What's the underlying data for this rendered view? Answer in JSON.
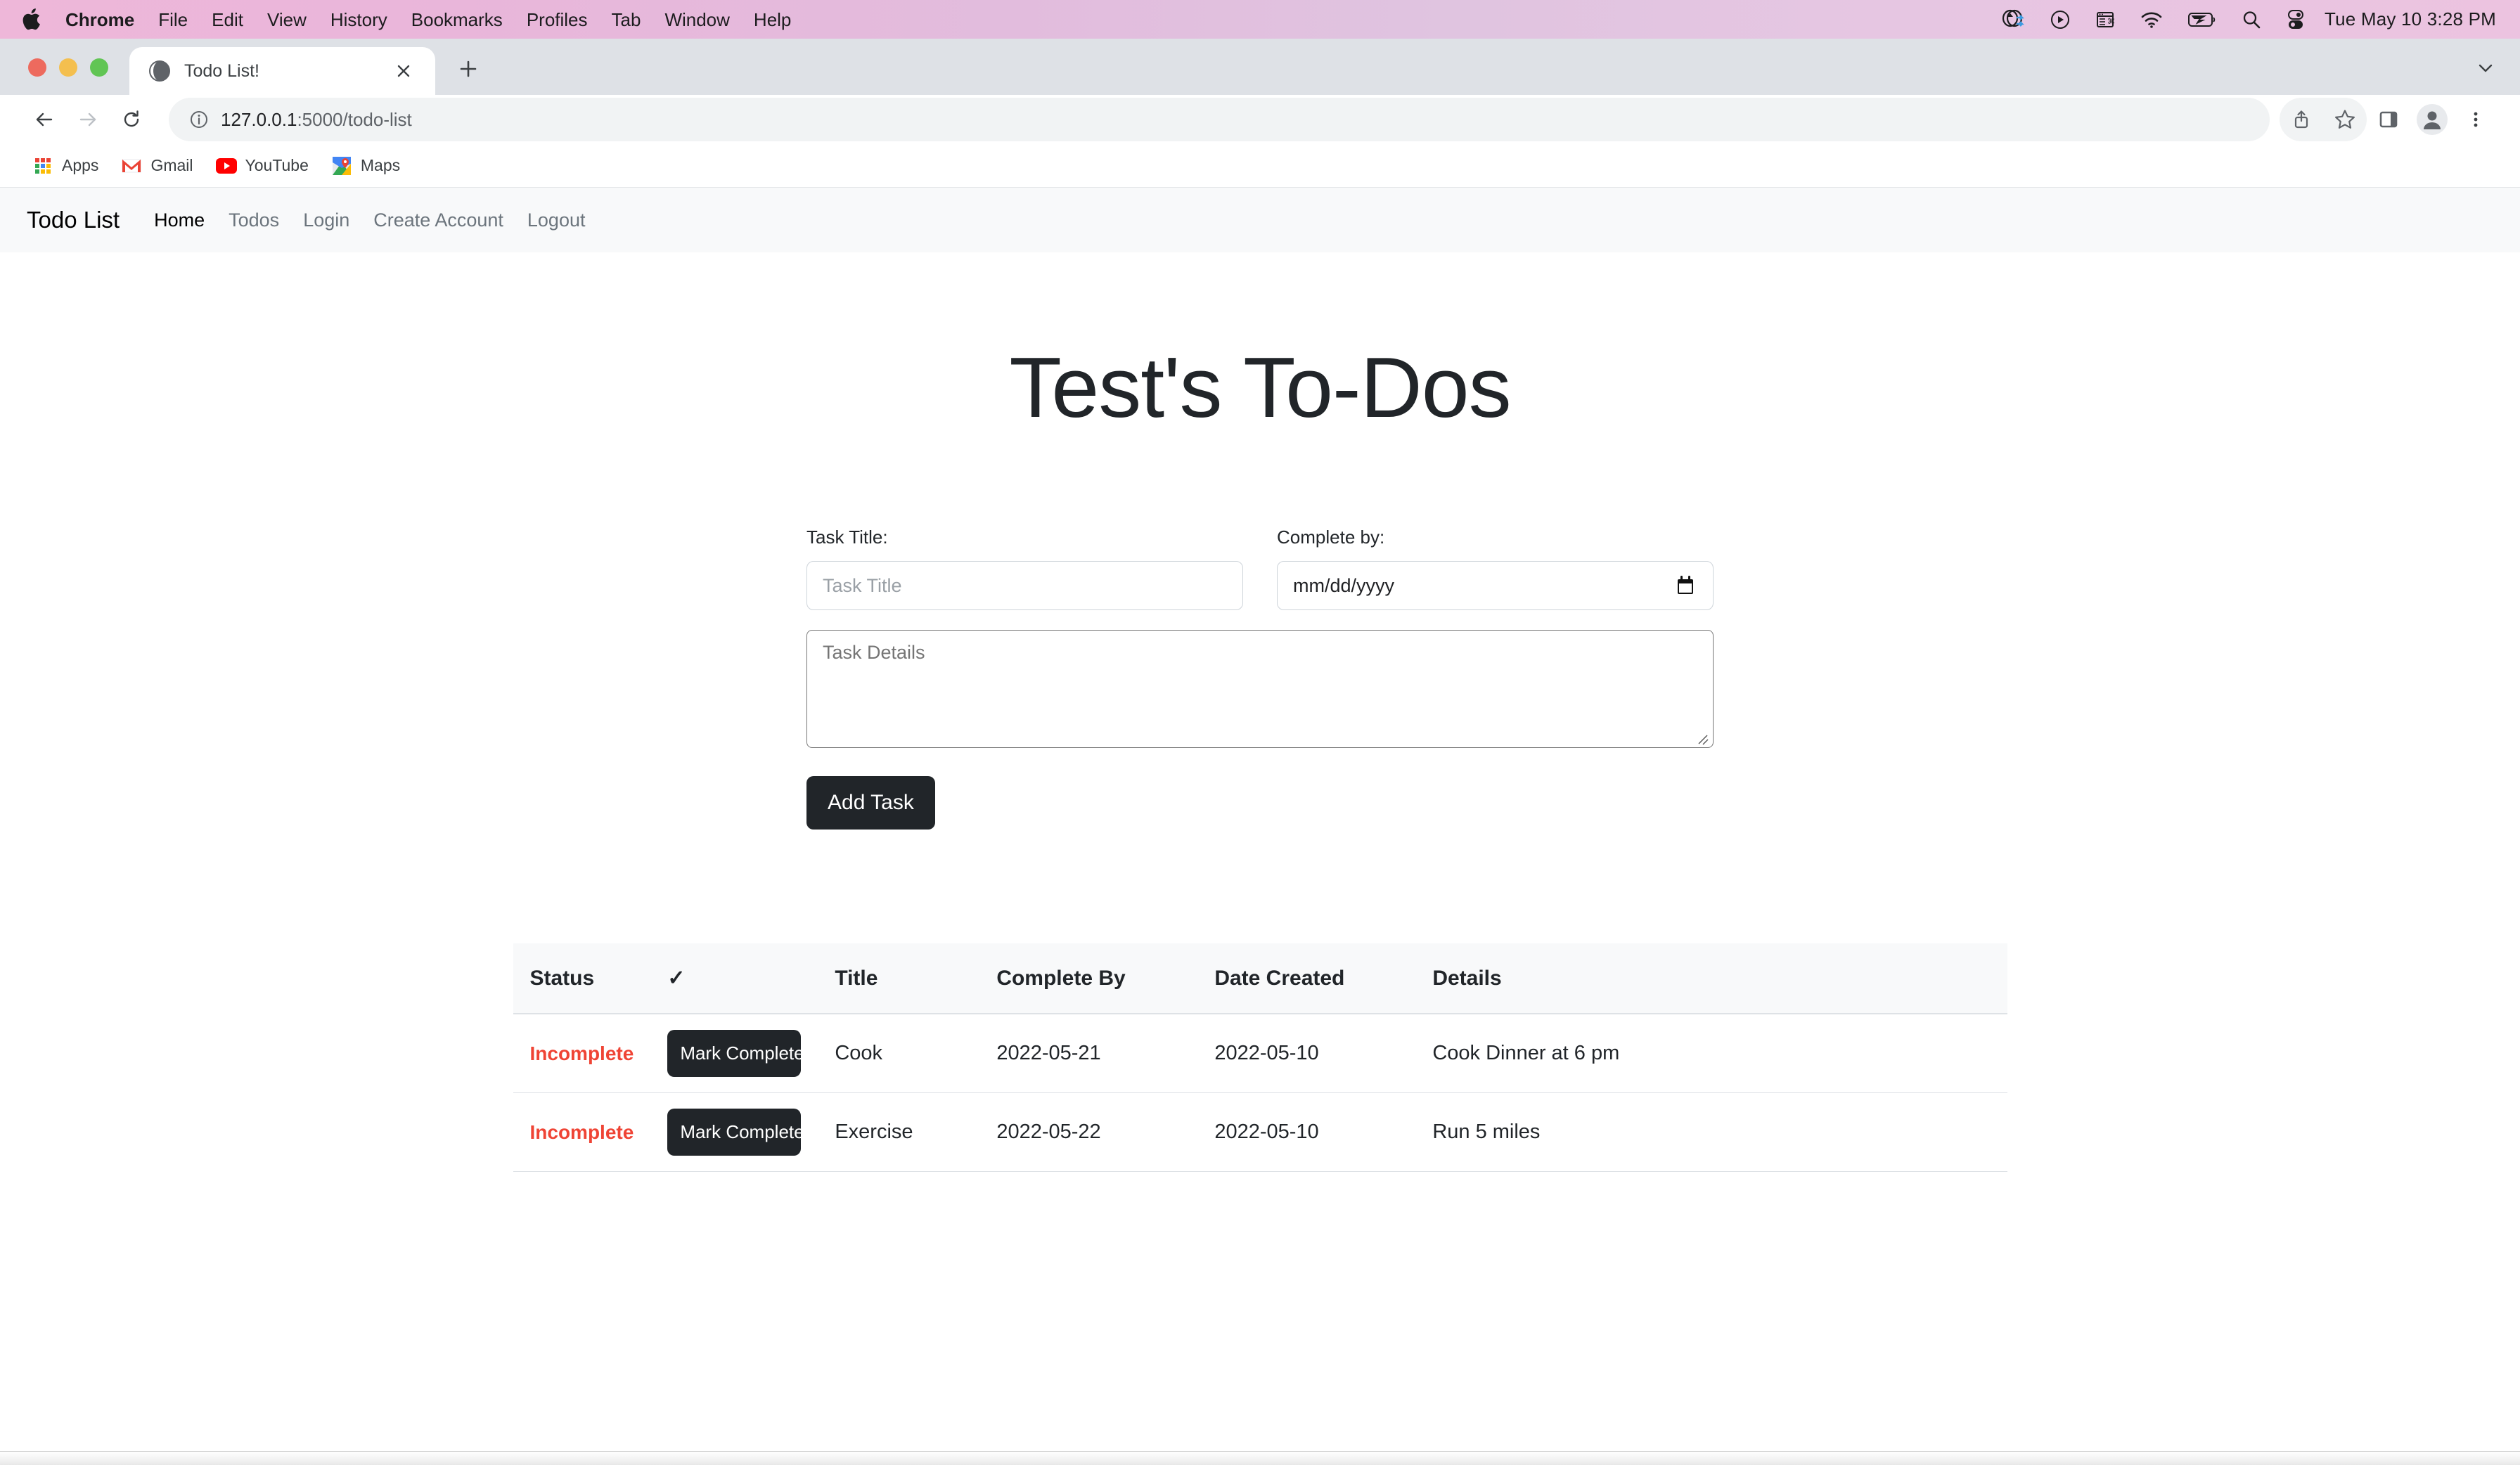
{
  "menubar": {
    "app_name": "Chrome",
    "items": [
      "Chrome",
      "File",
      "Edit",
      "View",
      "History",
      "Bookmarks",
      "Profiles",
      "Tab",
      "Window",
      "Help"
    ],
    "status_icons": [
      "vpn-icon",
      "play-circle-icon",
      "window-manager-icon",
      "wifi-icon",
      "battery-charging-icon",
      "search-icon",
      "control-center-icon"
    ],
    "clock": "Tue May 10  3:28 PM"
  },
  "browser": {
    "tab": {
      "title": "Todo List!",
      "favicon": "globe-icon",
      "close_label": "×"
    },
    "new_tab_label": "+",
    "toolbar": {
      "back": "back-arrow-icon",
      "forward": "forward-arrow-icon",
      "reload": "reload-icon",
      "url_host": "127.0.0.1",
      "url_path": ":5000/todo-list",
      "url_full": "127.0.0.1:5000/todo-list",
      "site_info": "info-circle-icon",
      "share": "share-icon",
      "bookmark": "star-icon",
      "side_panel": "side-panel-icon",
      "profile": "profile-avatar-icon",
      "menu": "three-dot-menu-icon"
    },
    "bookmarks": [
      {
        "label": "Apps",
        "icon": "apps-grid-icon"
      },
      {
        "label": "Gmail",
        "icon": "gmail-icon"
      },
      {
        "label": "YouTube",
        "icon": "youtube-icon"
      },
      {
        "label": "Maps",
        "icon": "maps-icon"
      }
    ]
  },
  "site": {
    "navbar": {
      "brand": "Todo List",
      "links": [
        {
          "label": "Home",
          "active": true
        },
        {
          "label": "Todos",
          "active": false
        },
        {
          "label": "Login",
          "active": false
        },
        {
          "label": "Create Account",
          "active": false
        },
        {
          "label": "Logout",
          "active": false
        }
      ]
    },
    "heading": "Test's To-Dos",
    "form": {
      "title_label": "Task Title:",
      "title_placeholder": "Task Title",
      "title_value": "",
      "date_label": "Complete by:",
      "date_placeholder": "mm/dd/yyyy",
      "date_value": "",
      "date_icon": "calendar-icon",
      "details_placeholder": "Task Details",
      "details_value": "",
      "submit_label": "Add Task"
    },
    "table": {
      "headers": [
        "Status",
        "✓",
        "Title",
        "Complete By",
        "Date Created",
        "Details"
      ],
      "rows": [
        {
          "status": "Incomplete",
          "action": "Mark Complete",
          "title": "Cook",
          "complete_by": "2022-05-21",
          "date_created": "2022-05-10",
          "details": "Cook Dinner at 6 pm"
        },
        {
          "status": "Incomplete",
          "action": "Mark Complete",
          "title": "Exercise",
          "complete_by": "2022-05-22",
          "date_created": "2022-05-10",
          "details": "Run 5 miles"
        }
      ]
    },
    "colors": {
      "status_incomplete": "#ef4435",
      "button_dark": "#212529",
      "navbar_bg": "#f8f9fa",
      "table_head_bg": "#f8f9fa"
    }
  }
}
